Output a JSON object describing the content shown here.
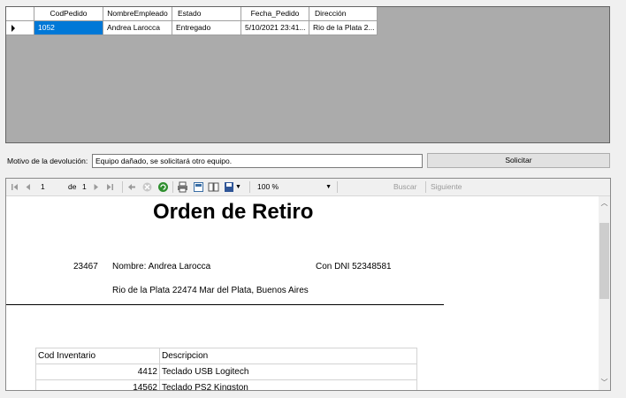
{
  "grid": {
    "columns": [
      "CodPedido",
      "NombreEmpleado",
      "Estado",
      "Fecha_Pedido",
      "Dirección"
    ],
    "rows": [
      [
        "1052",
        "Andrea Larocca",
        "Entregado",
        "5/10/2021 23:41...",
        "Rio de la Plata 2..."
      ]
    ]
  },
  "reason": {
    "label": "Motivo de la devolución:",
    "value": "Equipo dañado, se solicitará otro equipo."
  },
  "request_button": "Solicitar",
  "viewer": {
    "page": "1",
    "of_label": "de",
    "total_pages": "1",
    "zoom": "100 %",
    "search_label": "Buscar",
    "next_label": "Siguiente"
  },
  "report": {
    "title": "Orden de Retiro",
    "id": "23467",
    "name_line": "Nombre: Andrea Larocca",
    "dni_line": "Con DNI 52348581",
    "address": "Rio de la Plata 22474 Mar del Plata, Buenos Aires",
    "table_headers": [
      "Cod Inventario",
      "Descripcion"
    ],
    "items": [
      {
        "code": "4412",
        "description": "Teclado USB Logitech"
      },
      {
        "code": "14562",
        "description": "Teclado PS2 Kingston"
      }
    ]
  },
  "colors": {
    "selection": "#0078d7",
    "grid_background": "#ababab"
  }
}
